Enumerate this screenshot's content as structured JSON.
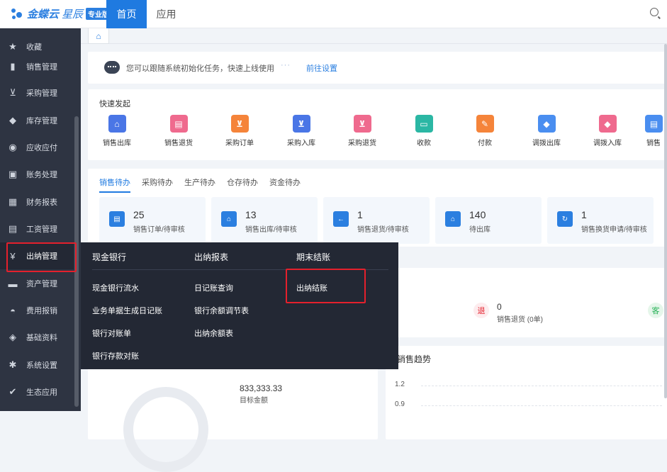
{
  "header": {
    "brand": "金蝶云",
    "brand_sub": "星辰",
    "edition": "专业版",
    "tabs": [
      "首页",
      "应用"
    ]
  },
  "sidebar": {
    "items": [
      {
        "icon": "star-icon",
        "label": "收藏"
      },
      {
        "icon": "bar-chart-icon",
        "label": "销售管理"
      },
      {
        "icon": "cart-icon",
        "label": "采购管理"
      },
      {
        "icon": "box-icon",
        "label": "库存管理"
      },
      {
        "icon": "coin-icon",
        "label": "应收应付"
      },
      {
        "icon": "ledger-icon",
        "label": "账务处理"
      },
      {
        "icon": "report-icon",
        "label": "财务报表"
      },
      {
        "icon": "salary-icon",
        "label": "工资管理"
      },
      {
        "icon": "yen-icon",
        "label": "出纳管理"
      },
      {
        "icon": "asset-icon",
        "label": "资产管理"
      },
      {
        "icon": "expense-icon",
        "label": "费用报销"
      },
      {
        "icon": "layers-icon",
        "label": "基础资料"
      },
      {
        "icon": "gear-icon",
        "label": "系统设置"
      },
      {
        "icon": "eco-icon",
        "label": "生态应用"
      }
    ],
    "active_index": 8
  },
  "guide": {
    "text": "您可以跟随系统初始化任务，快速上线使用",
    "dots": "···",
    "link": "前往设置"
  },
  "quick": {
    "title": "快速发起",
    "items": [
      {
        "label": "销售出库",
        "color": "#4a76e6",
        "icon": "house-icon"
      },
      {
        "label": "销售退货",
        "color": "#ef6a8e",
        "icon": "return-icon"
      },
      {
        "label": "采购订单",
        "color": "#f5843a",
        "icon": "cart-icon"
      },
      {
        "label": "采购入库",
        "color": "#4a76e6",
        "icon": "cart-icon"
      },
      {
        "label": "采购退货",
        "color": "#ef6a8e",
        "icon": "cart-icon"
      },
      {
        "label": "收款",
        "color": "#2bb7a4",
        "icon": "receipt-icon"
      },
      {
        "label": "付款",
        "color": "#f5843a",
        "icon": "pay-icon"
      },
      {
        "label": "调拨出库",
        "color": "#4a8ef0",
        "icon": "transfer-icon"
      },
      {
        "label": "调拨入库",
        "color": "#ef6a8e",
        "icon": "transfer-icon"
      },
      {
        "label": "销售",
        "color": "#4a8ef0",
        "icon": "sale-icon"
      }
    ]
  },
  "todo": {
    "tabs": [
      "销售待办",
      "采购待办",
      "生产待办",
      "仓存待办",
      "资金待办"
    ],
    "cards": [
      {
        "num": "25",
        "label": "销售订单/待审核",
        "icon": "order-icon"
      },
      {
        "num": "13",
        "label": "销售出库/待审核",
        "icon": "house-icon"
      },
      {
        "num": "1",
        "label": "销售退货/待审核",
        "icon": "return-icon"
      },
      {
        "num": "140",
        "label": "待出库",
        "icon": "warehouse-icon"
      },
      {
        "num": "1",
        "label": "销售换货申请/待审核",
        "icon": "exchange-icon"
      }
    ]
  },
  "mid": {
    "return_badge": "退",
    "return_num": "0",
    "return_label": "销售退货 (0单)",
    "customer_badge": "客"
  },
  "bottom": {
    "amount": "833,333.33",
    "amount_label": "目标金额",
    "trend_title": "销售趋势",
    "y_ticks": [
      "1.2",
      "0.9"
    ]
  },
  "dropdown": {
    "columns": [
      {
        "head": "现金银行",
        "items": [
          "现金银行流水",
          "业务单据生成日记账",
          "银行对账单",
          "银行存款对账"
        ]
      },
      {
        "head": "出纳报表",
        "items": [
          "日记账查询",
          "银行余额调节表",
          "出纳余额表"
        ]
      },
      {
        "head": "期末结账",
        "items": [
          "出纳结账"
        ]
      }
    ]
  },
  "colors": {
    "primary": "#1f7ae0",
    "sidebar_bg": "#2e3442",
    "highlight": "#e4202c"
  }
}
